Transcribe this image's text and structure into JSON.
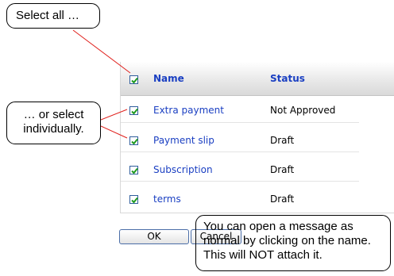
{
  "callouts": {
    "select_all": "Select all …",
    "select_individually": "… or select individually.",
    "open_message": "You can open a message as normal by clicking on the name. This will NOT attach it."
  },
  "table": {
    "columns": [
      "Name",
      "Status"
    ],
    "rows": [
      {
        "name": "Extra payment",
        "status": "Not Approved",
        "checked": true
      },
      {
        "name": "Payment slip",
        "status": "Draft",
        "checked": true
      },
      {
        "name": "Subscription",
        "status": "Draft",
        "checked": true
      },
      {
        "name": "terms",
        "status": "Draft",
        "checked": true
      }
    ],
    "header_checked": true
  },
  "buttons": {
    "ok": "OK",
    "cancel": "Cancel"
  },
  "colors": {
    "link": "#1a3fc2",
    "check": "#1e9a1e",
    "callout_line": "#e0201c"
  }
}
